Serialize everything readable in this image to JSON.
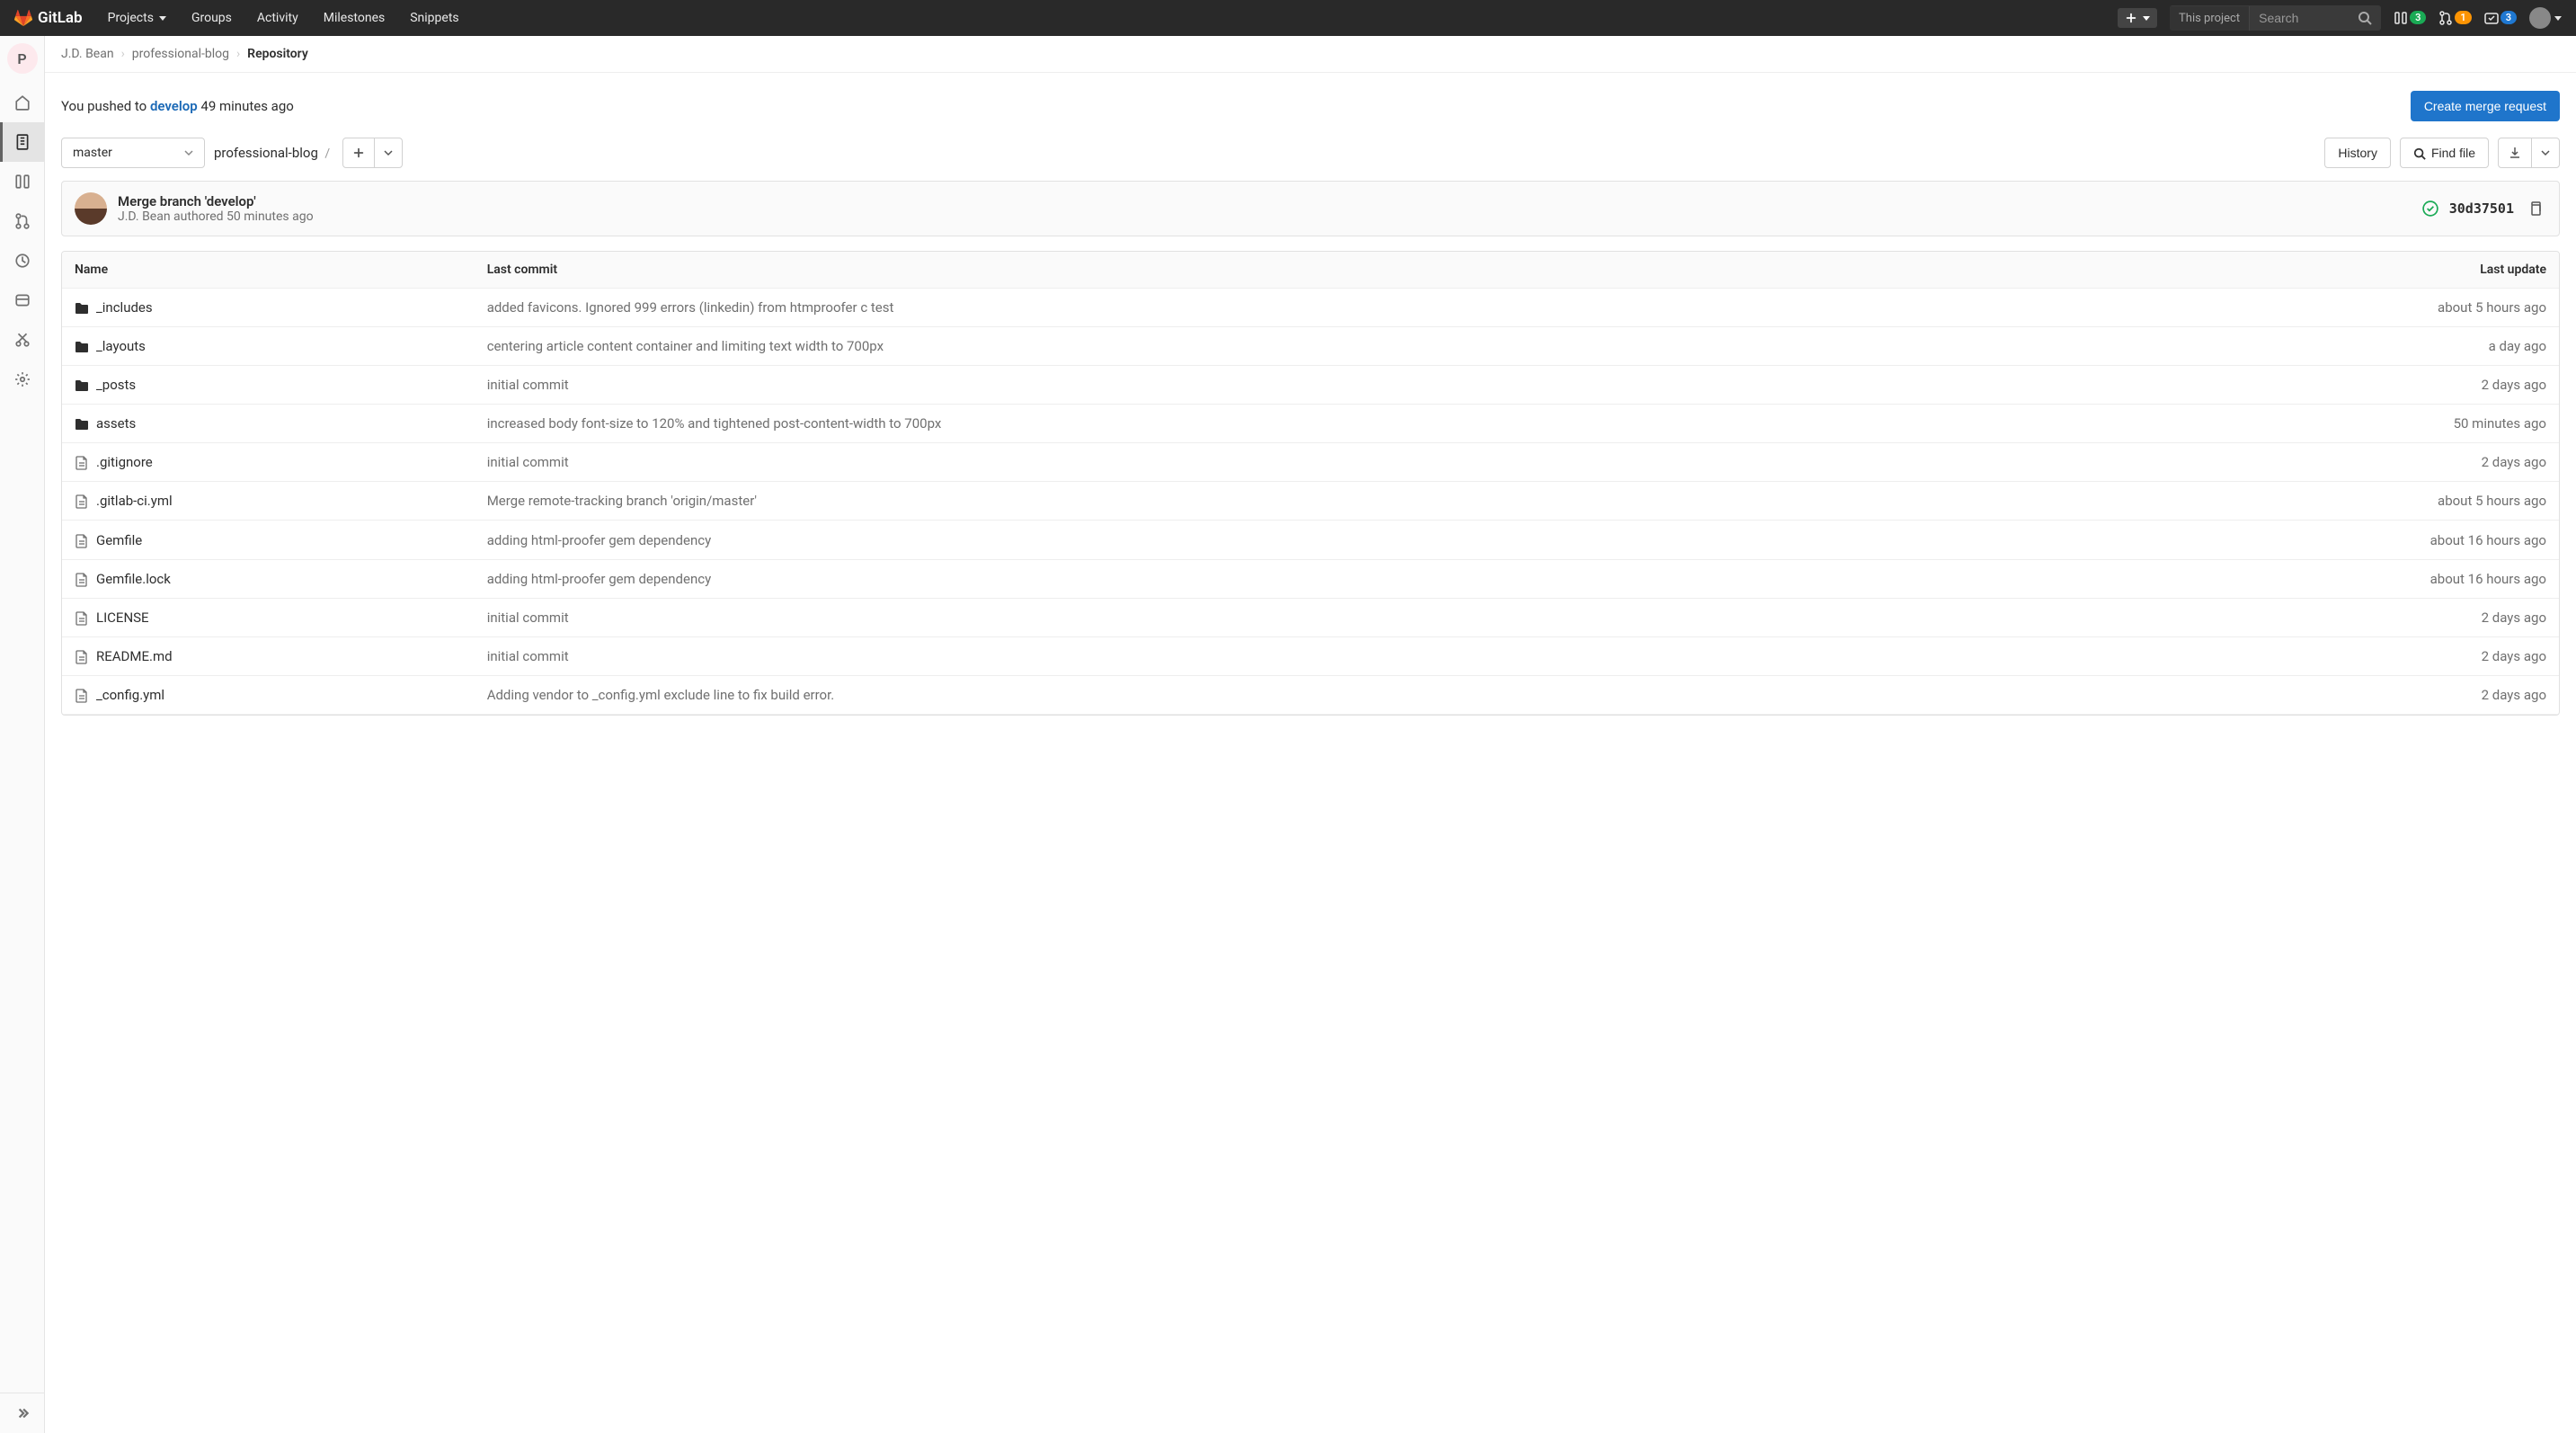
{
  "navbar": {
    "brand": "GitLab",
    "links": {
      "projects": "Projects",
      "groups": "Groups",
      "activity": "Activity",
      "milestones": "Milestones",
      "snippets": "Snippets"
    },
    "search_scope": "This project",
    "search_placeholder": "Search",
    "issues_count": "3",
    "mr_count": "1",
    "todos_count": "3"
  },
  "sidebar": {
    "project_letter": "P"
  },
  "breadcrumbs": {
    "owner": "J.D. Bean",
    "project": "professional-blog",
    "page": "Repository"
  },
  "push_alert": {
    "prefix": "You pushed to ",
    "branch": "develop",
    "suffix": " 49 minutes ago",
    "button": "Create merge request"
  },
  "toolbar": {
    "branch": "master",
    "path_project": "professional-blog",
    "history": "History",
    "find_file": "Find file"
  },
  "last_commit": {
    "title": "Merge branch 'develop'",
    "meta": "J.D. Bean authored 50 minutes ago",
    "sha": "30d37501"
  },
  "table": {
    "headers": {
      "name": "Name",
      "last_commit": "Last commit",
      "last_update": "Last update"
    },
    "rows": [
      {
        "type": "folder",
        "name": "_includes",
        "commit": "added favicons. Ignored 999 errors (linkedin) from htmproofer c test",
        "updated": "about 5 hours ago"
      },
      {
        "type": "folder",
        "name": "_layouts",
        "commit": "centering article content container and limiting text width to 700px",
        "updated": "a day ago"
      },
      {
        "type": "folder",
        "name": "_posts",
        "commit": "initial commit",
        "updated": "2 days ago"
      },
      {
        "type": "folder",
        "name": "assets",
        "commit": "increased body font-size to 120% and tightened post-content-width to 700px",
        "updated": "50 minutes ago"
      },
      {
        "type": "file",
        "name": ".gitignore",
        "commit": "initial commit",
        "updated": "2 days ago"
      },
      {
        "type": "file",
        "name": ".gitlab-ci.yml",
        "commit": "Merge remote-tracking branch 'origin/master'",
        "updated": "about 5 hours ago"
      },
      {
        "type": "file",
        "name": "Gemfile",
        "commit": "adding html-proofer gem dependency",
        "updated": "about 16 hours ago"
      },
      {
        "type": "file",
        "name": "Gemfile.lock",
        "commit": "adding html-proofer gem dependency",
        "updated": "about 16 hours ago"
      },
      {
        "type": "file",
        "name": "LICENSE",
        "commit": "initial commit",
        "updated": "2 days ago"
      },
      {
        "type": "file",
        "name": "README.md",
        "commit": "initial commit",
        "updated": "2 days ago"
      },
      {
        "type": "file",
        "name": "_config.yml",
        "commit": "Adding vendor to _config.yml exclude line to fix build error.",
        "updated": "2 days ago"
      }
    ]
  }
}
